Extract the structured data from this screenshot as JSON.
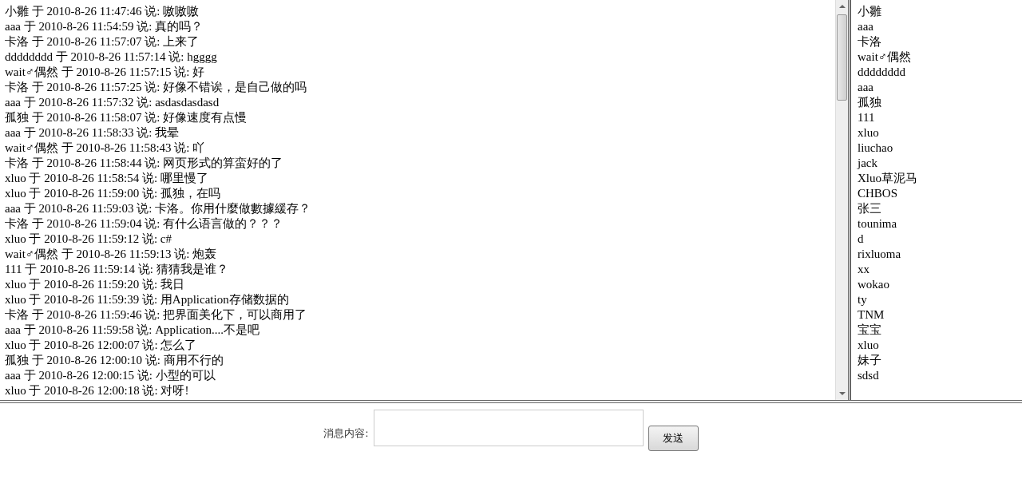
{
  "messages": [
    {
      "text": "小雛 于 2010-8-26 11:47:46 说: 嗷嗷嗷"
    },
    {
      "text": "aaa 于 2010-8-26 11:54:59 说: 真的吗？"
    },
    {
      "text": "卡洛 于 2010-8-26 11:57:07 说: 上来了"
    },
    {
      "text": "dddddddd 于 2010-8-26 11:57:14 说: hgggg"
    },
    {
      "text": "wait♂偶然 于 2010-8-26 11:57:15 说: 好"
    },
    {
      "text": "卡洛 于 2010-8-26 11:57:25 说: 好像不错诶，是自己做的吗"
    },
    {
      "text": "aaa 于 2010-8-26 11:57:32 说: asdasdasdasd"
    },
    {
      "text": "孤独 于 2010-8-26 11:58:07 说: 好像速度有点慢"
    },
    {
      "text": "aaa 于 2010-8-26 11:58:33 说: 我晕"
    },
    {
      "text": "wait♂偶然 于 2010-8-26 11:58:43 说: 吖"
    },
    {
      "text": "卡洛 于 2010-8-26 11:58:44 说: 网页形式的算蛮好的了"
    },
    {
      "text": "xluo 于 2010-8-26 11:58:54 说: 哪里慢了"
    },
    {
      "text": "xluo 于 2010-8-26 11:59:00 说: 孤独，在吗"
    },
    {
      "text": "aaa 于 2010-8-26 11:59:03 说: 卡洛。你用什麼做數據緩存？"
    },
    {
      "text": "卡洛 于 2010-8-26 11:59:04 说: 有什么语言做的？？？"
    },
    {
      "text": "xluo 于 2010-8-26 11:59:12 说: c#"
    },
    {
      "text": "wait♂偶然 于 2010-8-26 11:59:13 说: 炮轰"
    },
    {
      "text": "111 于 2010-8-26 11:59:14 说: 猜猜我是谁？"
    },
    {
      "text": "xluo 于 2010-8-26 11:59:20 说: 我日"
    },
    {
      "text": "xluo 于 2010-8-26 11:59:39 说: 用Application存储数据的"
    },
    {
      "text": "卡洛 于 2010-8-26 11:59:46 说: 把界面美化下，可以商用了"
    },
    {
      "text": "aaa 于 2010-8-26 11:59:58 说: Application....不是吧"
    },
    {
      "text": "xluo 于 2010-8-26 12:00:07 说: 怎么了"
    },
    {
      "text": "孤独 于 2010-8-26 12:00:10 说: 商用不行的"
    },
    {
      "text": "aaa 于 2010-8-26 12:00:15 说: 小型的可以"
    },
    {
      "text": "xluo 于 2010-8-26 12:00:18 说: 对呀!"
    }
  ],
  "users": [
    "小雛",
    "aaa",
    "卡洛",
    "wait♂偶然",
    "dddddddd",
    "aaa",
    "孤独",
    "111",
    "xluo",
    "liuchao",
    "jack",
    "Xluo草泥马",
    "CHBOS",
    "张三",
    "tounima",
    "d",
    "rixluoma",
    "xx",
    "wokao",
    "ty",
    "TNM",
    "宝宝",
    "xluo",
    "妹子",
    "sdsd"
  ],
  "composer": {
    "label": "消息内容:",
    "send_button": "发送"
  }
}
